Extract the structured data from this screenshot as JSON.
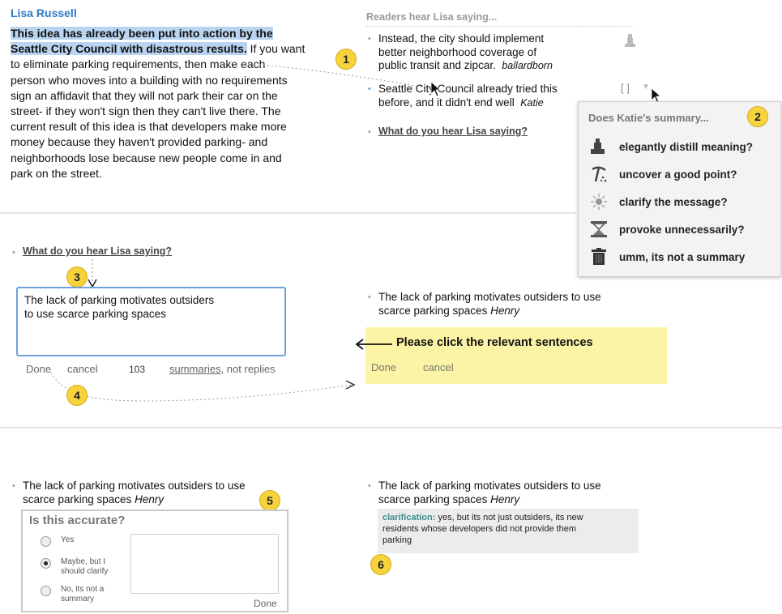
{
  "row1": {
    "author": "Lisa Russell",
    "para_hl1": "This idea has already been put into action by the",
    "para_hl2": "Seattle City Council with disastrous results.",
    "para_rest1": " If you want",
    "para_lines": [
      "to eliminate parking requirements, then make each",
      "person who moves into a building with no requirements",
      "sign an affidavit that they will not park their car on the",
      "street- if they won't sign then they can't live there. The",
      "current result of this idea is that developers make more",
      "money because they haven't provided parking- and",
      "neighborhoods lose because new people come in and",
      "park on the street."
    ],
    "readers_head": "Readers hear Lisa saying...",
    "summary1_lines": [
      "Instead, the city should implement",
      "better neighborhood coverage of",
      "public transit and zipcar."
    ],
    "summary1_author": "ballardborn",
    "summary2_lines": [
      "Seattle City Council already tried this",
      "before, and it didn't end well"
    ],
    "summary2_author": "Katie",
    "bracket": "[ ]",
    "what_link": "What do you hear Lisa saying?",
    "popup": {
      "title": "Does Katie's summary...",
      "items": [
        {
          "icon": "statue-icon",
          "label": "elegantly distill meaning?"
        },
        {
          "icon": "pickaxe-icon",
          "label": "uncover a good point?"
        },
        {
          "icon": "sun-icon",
          "label": "clarify the message?"
        },
        {
          "icon": "hourglass-icon",
          "label": "provoke unnecessarily?"
        },
        {
          "icon": "trash-icon",
          "label": "umm, its not a summary"
        }
      ]
    }
  },
  "row2": {
    "what_link": "What do you hear Lisa saying?",
    "textarea_value": "The lack of parking motivates outsiders\nto use scarce parking spaces",
    "done": "Done",
    "cancel": "cancel",
    "count": "103",
    "summaries": "summaries",
    "not_replies": ", not replies",
    "right_summary_lines": [
      "The lack of parking motivates outsiders to use",
      "scarce parking spaces"
    ],
    "right_summary_author": "Henry",
    "instruction": "Please click the relevant sentences",
    "yellow_done": "Done",
    "yellow_cancel": "cancel"
  },
  "row3": {
    "left_summary_lines": [
      "The lack of parking motivates outsiders to use",
      "scarce parking spaces"
    ],
    "left_summary_author": "Henry",
    "accurate_title": "Is this accurate?",
    "options": [
      "Yes",
      "Maybe, but I\nshould clarify",
      "No, its not a\nsummary"
    ],
    "selected_option": 1,
    "done": "Done",
    "right_summary_lines": [
      "The lack of parking motivates outsiders to use",
      "scarce parking spaces"
    ],
    "right_summary_author": "Henry",
    "clar_label": "clarification:",
    "clar_text": " yes, but its not just outsiders, its new\nresidents whose developers did not provide them\nparking"
  },
  "badges": [
    "1",
    "2",
    "3",
    "4",
    "5",
    "6"
  ],
  "colors": {
    "accent_blue": "#2f78c4",
    "highlight": "#b9d4f1",
    "badge_yellow": "#f6d23d",
    "note_yellow": "#fbf4a4"
  }
}
